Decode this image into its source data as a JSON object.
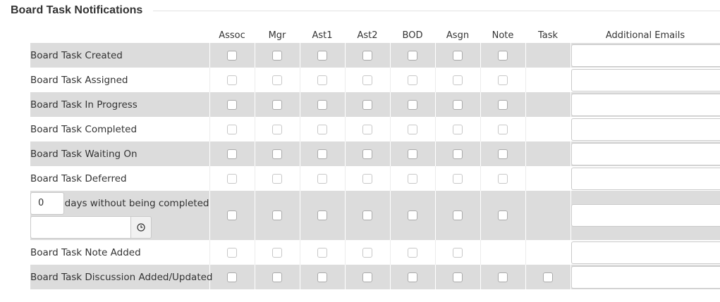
{
  "section": {
    "title": "Board Task Notifications"
  },
  "columns": [
    "Assoc",
    "Mgr",
    "Ast1",
    "Ast2",
    "BOD",
    "Asgn",
    "Note",
    "Task",
    "Additional Emails"
  ],
  "rows": [
    {
      "label": "Board Task Created"
    },
    {
      "label": "Board Task Assigned"
    },
    {
      "label": "Board Task In Progress"
    },
    {
      "label": "Board Task Completed"
    },
    {
      "label": "Board Task Waiting On"
    },
    {
      "label": "Board Task Deferred"
    },
    {
      "days_value": "0",
      "days_suffix": "days without being completed",
      "time_value": "",
      "time_icon": "clock-icon"
    },
    {
      "label": "Board Task Note Added"
    },
    {
      "label": "Board Task Discussion Added/Updated"
    }
  ]
}
